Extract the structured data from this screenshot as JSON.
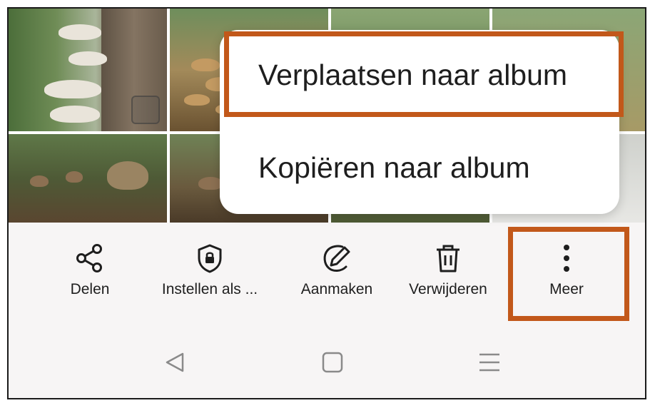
{
  "popup_menu": {
    "items": [
      {
        "label": "Verplaatsen naar album"
      },
      {
        "label": "Kopiëren naar album"
      }
    ]
  },
  "toolbar": {
    "items": [
      {
        "label": "Delen",
        "icon": "share-icon"
      },
      {
        "label": "Instellen als ...",
        "icon": "shield-lock-icon"
      },
      {
        "label": "Aanmaken",
        "icon": "edit-pencil-icon"
      },
      {
        "label": "Verwijderen",
        "icon": "trash-icon"
      },
      {
        "label": "Meer",
        "icon": "more-vertical-icon"
      }
    ]
  },
  "navigation_bar": {
    "items": [
      {
        "icon": "back-icon"
      },
      {
        "icon": "home-icon"
      },
      {
        "icon": "recents-icon"
      }
    ]
  },
  "colors": {
    "highlight": "#c2581a",
    "toolbar_background": "#f7f5f5",
    "text": "#1e1e1e"
  }
}
